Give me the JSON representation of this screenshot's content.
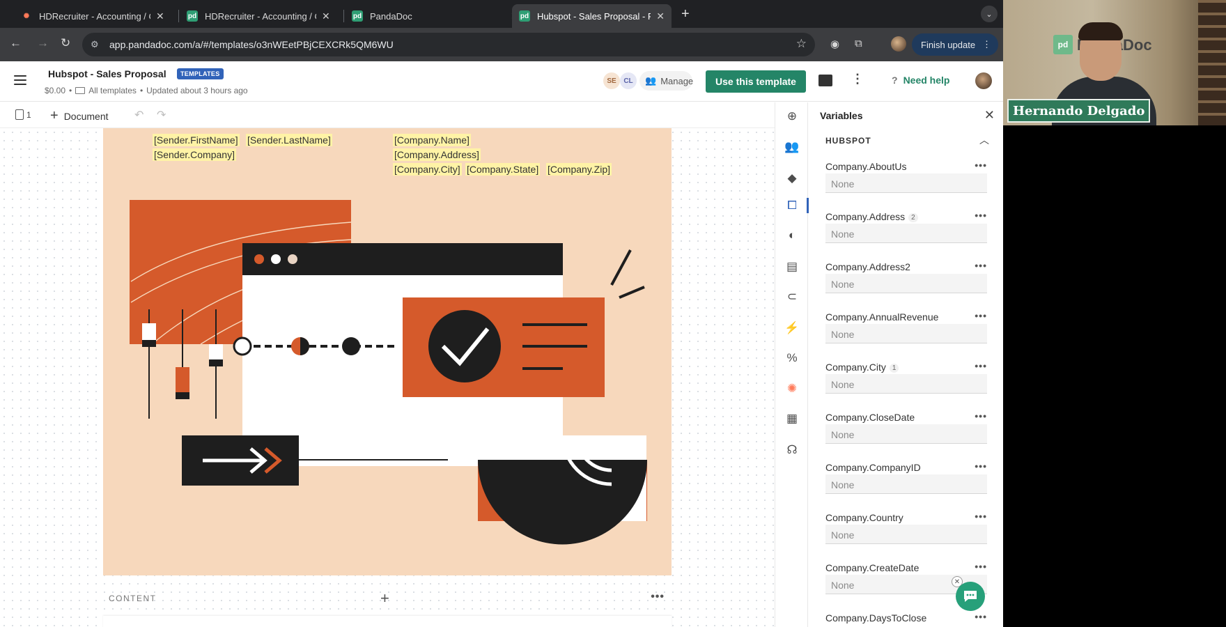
{
  "browser": {
    "tabs": [
      {
        "title": "HDRecruiter - Accounting / C",
        "favicon": "hubspot-icon"
      },
      {
        "title": "HDRecruiter - Accounting / C",
        "favicon": "pandadoc-icon"
      },
      {
        "title": "PandaDoc",
        "favicon": "pandadoc-icon"
      },
      {
        "title": "Hubspot - Sales Proposal - P",
        "favicon": "pandadoc-icon",
        "active": true
      }
    ],
    "url": "app.pandadoc.com/a/#/templates/o3nWEetPBjCEXCRk5QM6WU",
    "finish_update": "Finish update"
  },
  "header": {
    "title": "Hubspot - Sales Proposal",
    "badge": "TEMPLATES",
    "amount": "$0.00",
    "folder": "All templates",
    "updated": "Updated about 3 hours ago",
    "avatars": [
      "SE",
      "CL"
    ],
    "manage": "Manage",
    "use_template": "Use this template",
    "need_help": "Need help",
    "accent": "#248567"
  },
  "toolbar": {
    "pages_count": "1",
    "add_document": "Document"
  },
  "document": {
    "sender_lines": [
      "[Sender.FirstName]",
      "[Sender.LastName]",
      "[Sender.Company]"
    ],
    "company_lines": [
      "[Company.Name]",
      "[Company.Address]",
      "[Company.City]",
      "[Company.State]",
      "[Company.Zip]"
    ],
    "content_label": "CONTENT"
  },
  "variables_panel": {
    "title": "Variables",
    "group": "HUBSPOT",
    "items": [
      {
        "name": "Company.AboutUs",
        "count": "",
        "value": "None"
      },
      {
        "name": "Company.Address",
        "count": "2",
        "value": "None"
      },
      {
        "name": "Company.Address2",
        "count": "",
        "value": "None"
      },
      {
        "name": "Company.AnnualRevenue",
        "count": "",
        "value": "None"
      },
      {
        "name": "Company.City",
        "count": "1",
        "value": "None"
      },
      {
        "name": "Company.CloseDate",
        "count": "",
        "value": "None"
      },
      {
        "name": "Company.CompanyID",
        "count": "",
        "value": "None"
      },
      {
        "name": "Company.Country",
        "count": "",
        "value": "None"
      },
      {
        "name": "Company.CreateDate",
        "count": "",
        "value": "None"
      },
      {
        "name": "Company.DaysToClose",
        "count": "",
        "value": ""
      }
    ]
  },
  "webcam": {
    "name": "Hernando Delgado",
    "logo_text": "PandaDoc"
  }
}
